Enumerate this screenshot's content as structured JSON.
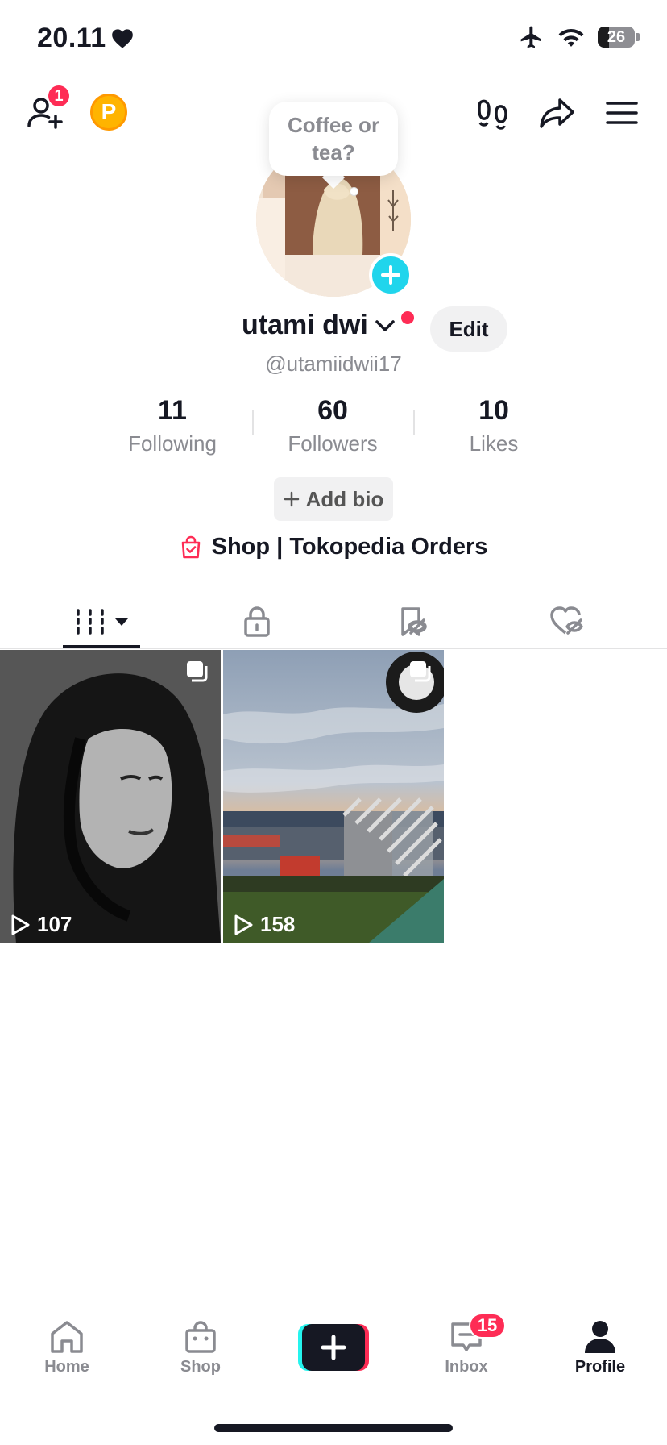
{
  "status_bar": {
    "time": "20.11",
    "battery": "26"
  },
  "top_bar": {
    "add_friend_badge": "1"
  },
  "profile": {
    "avatar_note": "Coffee or tea?",
    "display_name": "utami dwi",
    "edit_label": "Edit",
    "handle": "@utamiidwii17",
    "stats": [
      {
        "value": "11",
        "label": "Following"
      },
      {
        "value": "60",
        "label": "Followers"
      },
      {
        "value": "10",
        "label": "Likes"
      }
    ],
    "add_bio_label": "Add bio",
    "shop_link_label": "Shop | Tokopedia Orders"
  },
  "videos": [
    {
      "views": "107"
    },
    {
      "views": "158"
    }
  ],
  "bottom_nav": {
    "home": "Home",
    "shop": "Shop",
    "inbox": "Inbox",
    "inbox_badge": "15",
    "profile": "Profile"
  },
  "colors": {
    "accent_red": "#fe2c55",
    "accent_cyan": "#20d5ec",
    "text_primary": "#161823",
    "text_secondary": "#8a8b91"
  }
}
